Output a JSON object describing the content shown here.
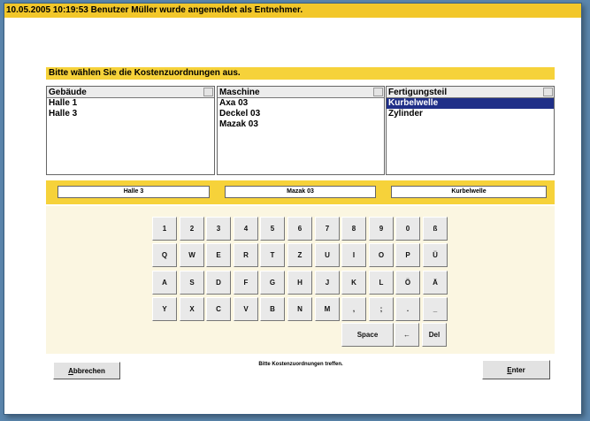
{
  "status_bar": "10.05.2005 10:19:53  Benutzer Müller wurde angemeldet als Entnehmer.",
  "instruction": "Bitte wählen Sie die Kostenzuordnungen aus.",
  "lists": [
    {
      "header": "Gebäude",
      "items": [
        "Halle 1",
        "Halle 3"
      ],
      "selected_index": -1
    },
    {
      "header": "Maschine",
      "items": [
        "Axa 03",
        "Deckel 03",
        "Mazak 03"
      ],
      "selected_index": -1
    },
    {
      "header": "Fertigungsteil",
      "items": [
        "Kurbelwelle",
        "Zylinder"
      ],
      "selected_index": 0
    }
  ],
  "selections": [
    "Halle 3",
    "Mazak 03",
    "Kurbelwelle"
  ],
  "keyboard": {
    "row1": [
      "1",
      "2",
      "3",
      "4",
      "5",
      "6",
      "7",
      "8",
      "9",
      "0",
      "ß"
    ],
    "row2": [
      "Q",
      "W",
      "E",
      "R",
      "T",
      "Z",
      "U",
      "I",
      "O",
      "P",
      "Ü"
    ],
    "row3": [
      "A",
      "S",
      "D",
      "F",
      "G",
      "H",
      "J",
      "K",
      "L",
      "Ö",
      "Ä"
    ],
    "row4": [
      "Y",
      "X",
      "C",
      "V",
      "B",
      "N",
      "M",
      ",",
      ";",
      ".",
      "_"
    ],
    "space": "Space",
    "back": "←",
    "del": "Del"
  },
  "buttons": {
    "cancel_underline": "A",
    "cancel_rest": "bbrechen",
    "enter_underline": "E",
    "enter_rest": "nter"
  },
  "message": "Bitte Kostenzuordnungen treffen.",
  "colors": {
    "accent_yellow": "#f6d23a",
    "selection_blue": "#1f2f88",
    "panel_cream": "#fbf6e1"
  }
}
